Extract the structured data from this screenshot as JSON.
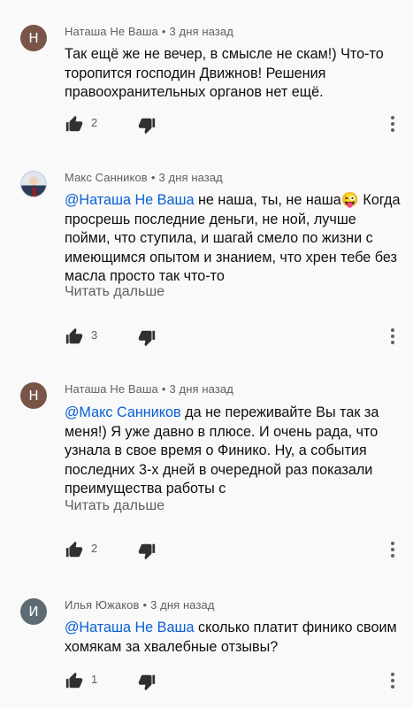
{
  "comments": [
    {
      "author": "Наташа Не Ваша",
      "time": "3 дня назад",
      "avatar_letter": "Н",
      "avatar_color": "#795548",
      "mention": "",
      "text": "Так ещё же не вечер, в смысле не скам!) Что-то торопится господин Движнов! Решения правоохранительных органов нет ещё.",
      "read_more": "",
      "likes": "2"
    },
    {
      "author": "Макс Санников",
      "time": "3 дня назад",
      "avatar_letter": "",
      "avatar_color": "",
      "mention": "@Наташа Не Ваша",
      "text": " не наша, ты, не наша😜 Когда просрешь последние деньги, не ной, лучше пойми, что ступила, и шагай смело по жизни с имеющимся опытом и знанием, что хрен тебе без масла просто так что-то",
      "read_more": "Читать дальше",
      "likes": "3"
    },
    {
      "author": "Наташа Не Ваша",
      "time": "3 дня назад",
      "avatar_letter": "Н",
      "avatar_color": "#795548",
      "mention": "@Макс Санников",
      "text": " да не переживайте Вы так за меня!) Я уже давно в плюсе. И очень рада, что узнала в свое время о Финико. Ну, а события последних 3-х дней в очередной раз показали преимущества работы с",
      "read_more": "Читать дальше",
      "likes": "2"
    },
    {
      "author": "Илья Южаков",
      "time": "3 дня назад",
      "avatar_letter": "И",
      "avatar_color": "#5d6b73",
      "mention": "@Наташа Не Ваша",
      "text": " сколько платит финико своим хомякам за хвалебные отзывы?",
      "read_more": "",
      "likes": "1"
    }
  ],
  "separator": "•",
  "icons": {
    "like": "thumb-up-icon",
    "dislike": "thumb-down-icon",
    "more": "more-vert-icon"
  }
}
